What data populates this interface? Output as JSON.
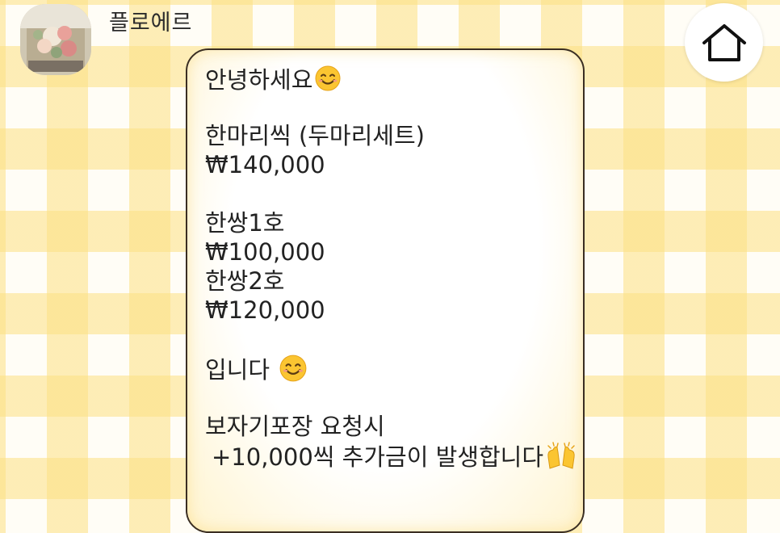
{
  "chat": {
    "sender_name": "플로에르",
    "avatar_icon": "flower-bouquet-photo",
    "home_icon": "home-icon"
  },
  "message": {
    "greeting": "안녕하세요",
    "item1_name": "한마리씩 (두마리세트)",
    "item1_price": "₩140,000",
    "item2_name": "한쌍1호",
    "item2_price": "₩100,000",
    "item3_name": "한쌍2호",
    "item3_price": "₩120,000",
    "closing": "입니다",
    "wrap_title": "보자기포장 요청시",
    "wrap_detail": "+10,000씩 추가금이 발생합니다"
  },
  "colors": {
    "check_yellow": "#fce082",
    "bubble_border": "#3a2e22",
    "text": "#222222"
  }
}
